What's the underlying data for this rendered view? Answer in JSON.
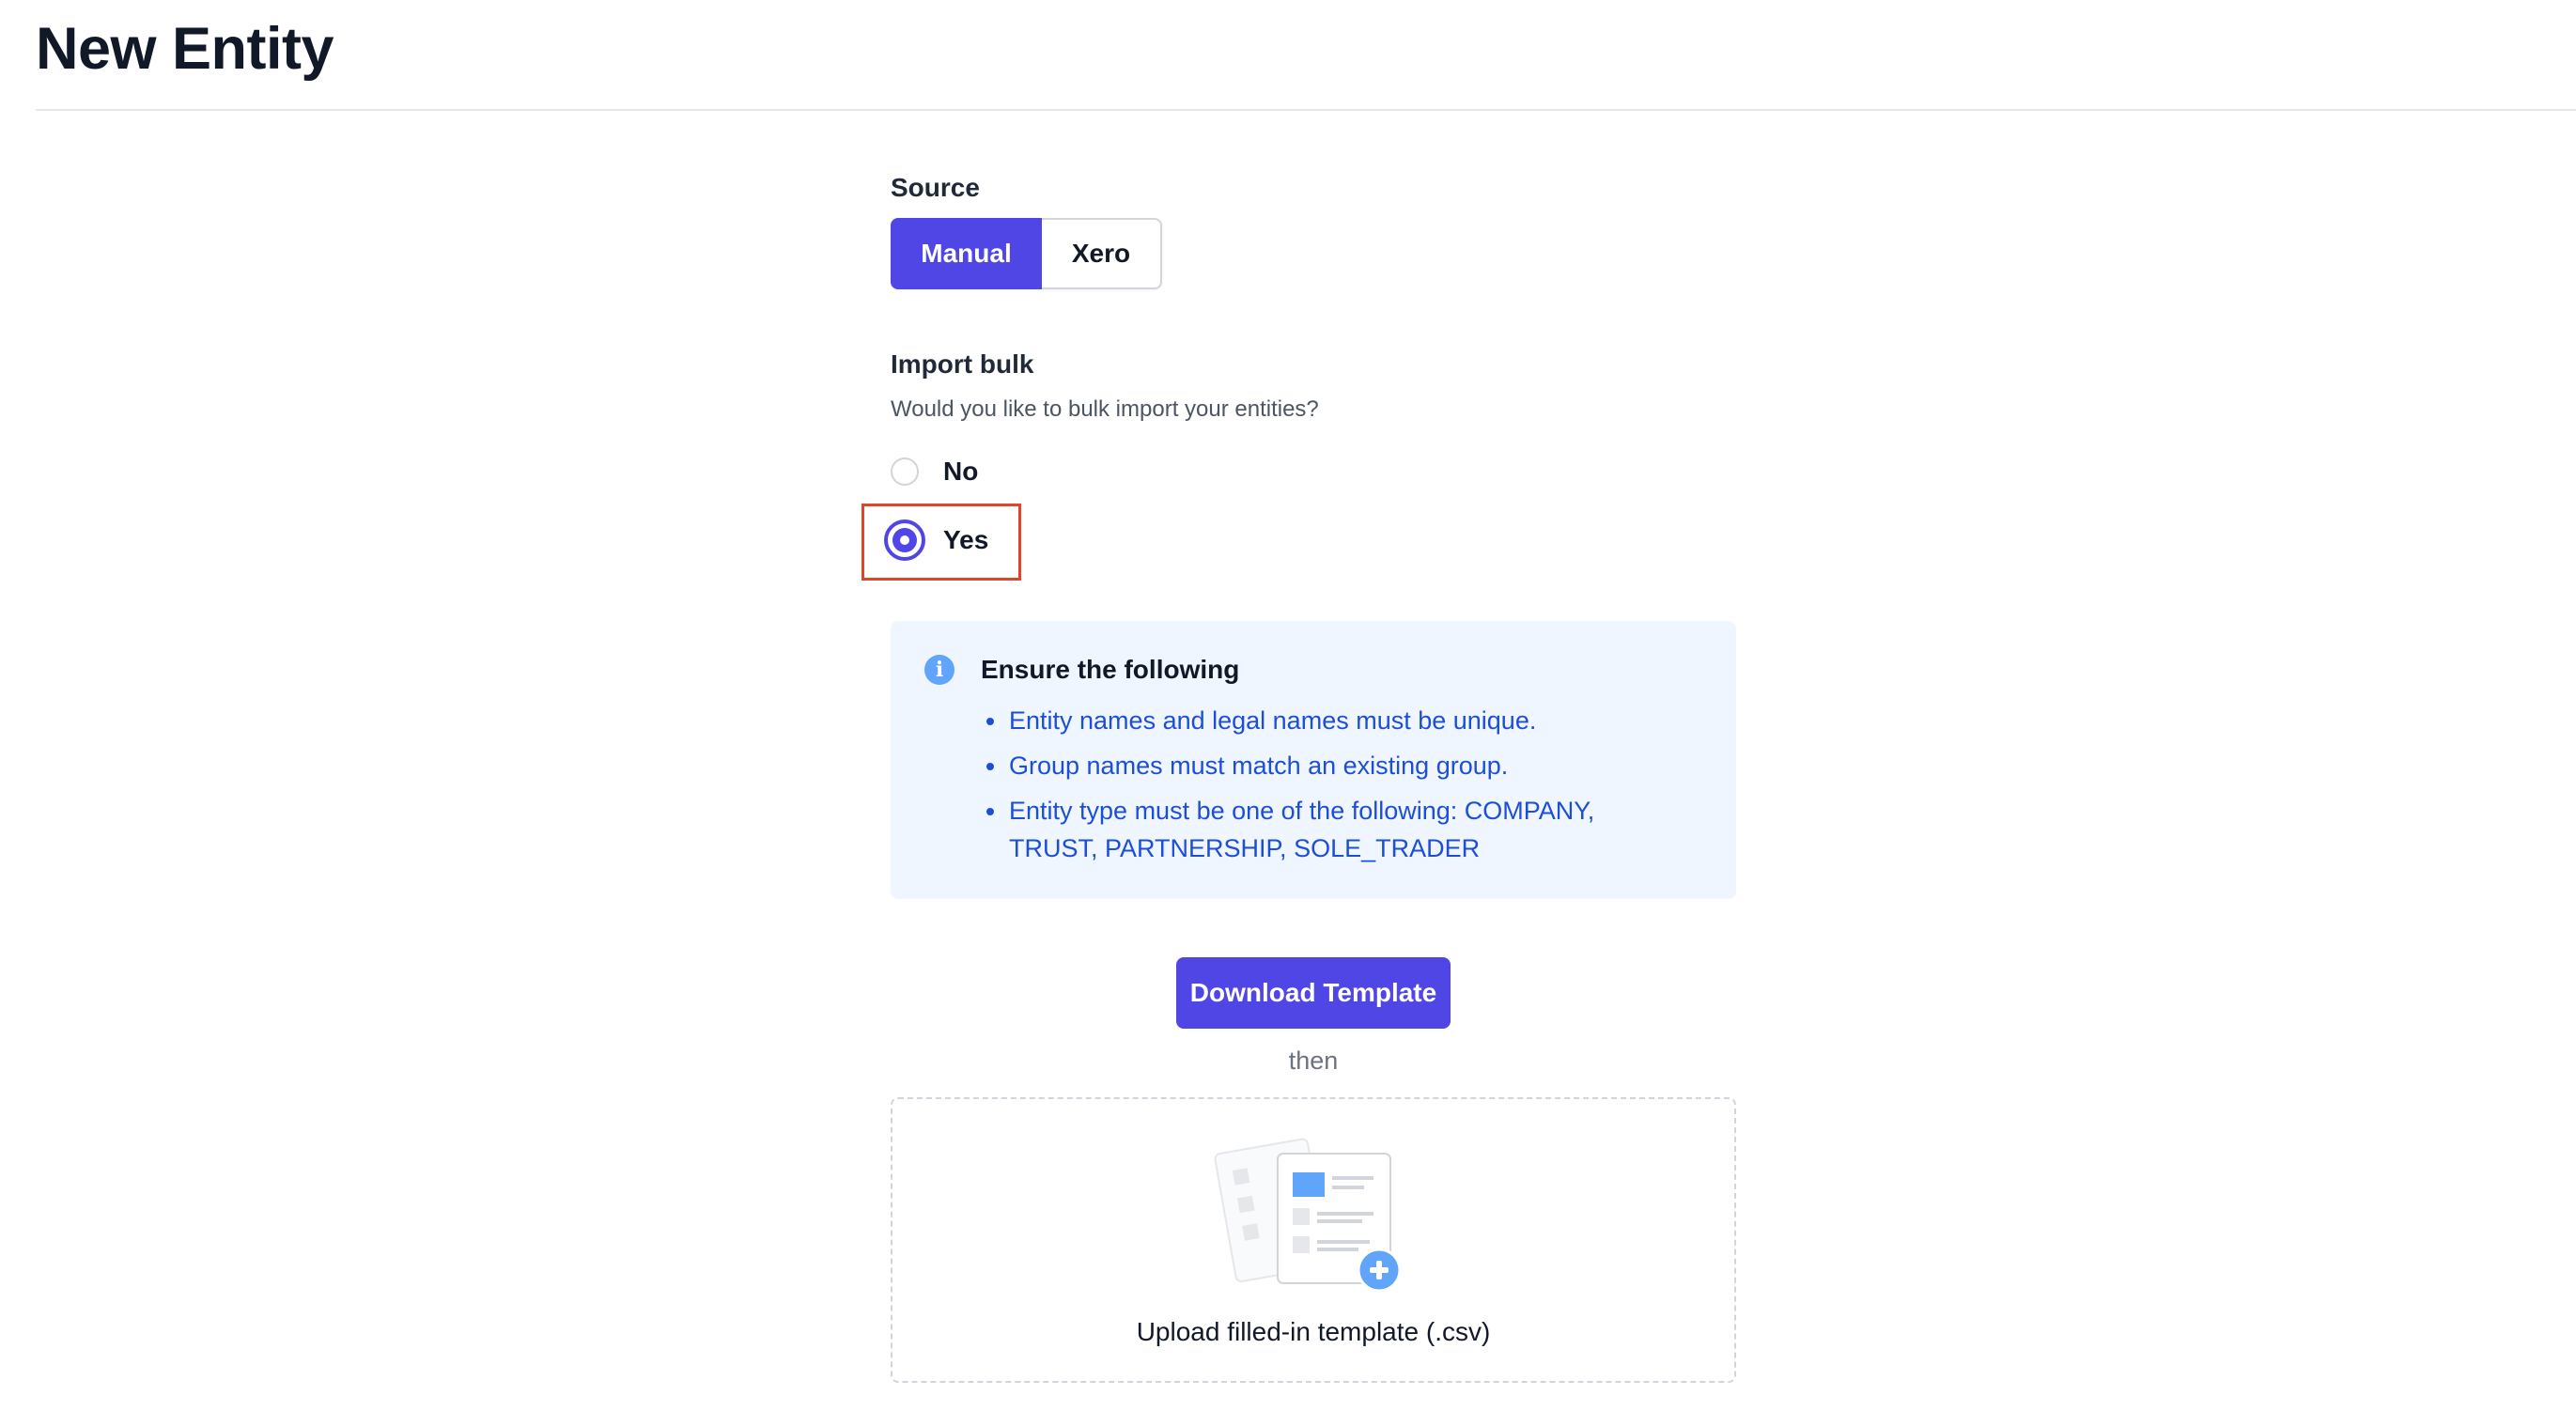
{
  "header": {
    "title": "New Entity"
  },
  "source": {
    "label": "Source",
    "options": [
      "Manual",
      "Xero"
    ],
    "selected": "Manual"
  },
  "import_bulk": {
    "label": "Import bulk",
    "help": "Would you like to bulk import your entities?",
    "options": [
      {
        "label": "No",
        "checked": false
      },
      {
        "label": "Yes",
        "checked": true
      }
    ]
  },
  "info": {
    "title": "Ensure the following",
    "items": [
      "Entity names and legal names must be unique.",
      "Group names must match an existing group.",
      "Entity type must be one of the following: COMPANY, TRUST, PARTNERSHIP, SOLE_TRADER"
    ]
  },
  "actions": {
    "download_label": "Download Template",
    "then_text": "then",
    "upload_label": "Upload filled-in template (.csv)"
  },
  "colors": {
    "primary": "#4f46e5",
    "info_bg": "#eff6ff",
    "info_text": "#1d4ed8",
    "highlight": "#e0452b"
  }
}
